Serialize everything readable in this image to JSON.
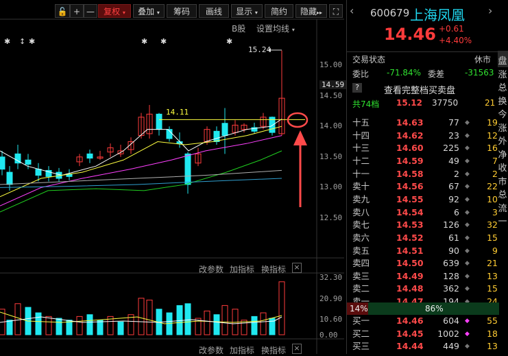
{
  "toolbar": {
    "lock": "🔓",
    "plus": "+",
    "minus": "—",
    "fuquan": "复权",
    "diejia": "叠加",
    "chouma": "筹码",
    "huaxian": "画线",
    "xianshi": "显示",
    "jianyue": "简约",
    "yincang": "隐藏",
    "expand": "⛶"
  },
  "chart": {
    "b_share": "B股",
    "settings": "设置均线",
    "high_label": "15.24",
    "ref_label": "14.11",
    "current_price_tag": "14.59",
    "price_ticks": [
      "15.00",
      "14.50",
      "14.00",
      "13.50",
      "13.00",
      "12.50"
    ],
    "vol_ticks": [
      "32.30",
      "20.90",
      "10.60",
      "0.00"
    ],
    "mid_controls": [
      "改参数",
      "加指标",
      "换指标"
    ],
    "bottom_controls": [
      "改参数",
      "加指标",
      "换指标"
    ],
    "close_x": "×"
  },
  "quote": {
    "code": "600679",
    "name": "上海凤凰",
    "price": "14.46",
    "change": "+0.61",
    "change_pct": "+4.40%",
    "trade_status_label": "交易状态",
    "trade_status": "休市",
    "tab": "盘",
    "weibi_label": "委比",
    "weibi": "-71.84%",
    "weicha_label": "委差",
    "weicha": "-31563",
    "help": "?",
    "full_book": "查看完整档买卖盘",
    "total_label": "共74档",
    "total_price": "15.12",
    "total_vol": "37750",
    "total_cnt": "21",
    "sells": [
      {
        "label": "十五",
        "price": "14.63",
        "vol": "77",
        "cnt": "19"
      },
      {
        "label": "十四",
        "price": "14.62",
        "vol": "23",
        "cnt": "12"
      },
      {
        "label": "十三",
        "price": "14.60",
        "vol": "225",
        "cnt": "16"
      },
      {
        "label": "十二",
        "price": "14.59",
        "vol": "49",
        "cnt": "7"
      },
      {
        "label": "十一",
        "price": "14.58",
        "vol": "2",
        "cnt": "2"
      },
      {
        "label": "卖十",
        "price": "14.56",
        "vol": "67",
        "cnt": "22"
      },
      {
        "label": "卖九",
        "price": "14.55",
        "vol": "92",
        "cnt": "10"
      },
      {
        "label": "卖八",
        "price": "14.54",
        "vol": "6",
        "cnt": "3"
      },
      {
        "label": "卖七",
        "price": "14.53",
        "vol": "126",
        "cnt": "32"
      },
      {
        "label": "卖六",
        "price": "14.52",
        "vol": "61",
        "cnt": "15"
      },
      {
        "label": "卖五",
        "price": "14.51",
        "vol": "90",
        "cnt": "9"
      },
      {
        "label": "卖四",
        "price": "14.50",
        "vol": "639",
        "cnt": "21"
      },
      {
        "label": "卖三",
        "price": "14.49",
        "vol": "128",
        "cnt": "13"
      },
      {
        "label": "卖二",
        "price": "14.48",
        "vol": "362",
        "cnt": "15"
      },
      {
        "label": "卖一",
        "price": "14.47",
        "vol": "194",
        "cnt": "24"
      }
    ],
    "ratio_left": "14%",
    "ratio_right": "86%",
    "buys": [
      {
        "label": "买一",
        "price": "14.46",
        "vol": "604",
        "cnt": "55",
        "dot": "#ff40ff"
      },
      {
        "label": "买二",
        "price": "14.45",
        "vol": "1002",
        "cnt": "18",
        "dot": "#ff40ff"
      },
      {
        "label": "买三",
        "price": "14.44",
        "vol": "449",
        "cnt": "13",
        "dot": "#777"
      }
    ],
    "side_chars": [
      "盘",
      "涨",
      "总",
      "换",
      "今",
      "涨",
      "外",
      "净",
      "收",
      "市",
      "总",
      "流",
      "一"
    ]
  },
  "colors": {
    "up": "#ff3b3b",
    "down": "#20e8f0",
    "ma5": "#ffffff",
    "ma10": "#ffff40",
    "ma20": "#ff40ff",
    "ma30": "#20d020",
    "ma60": "#b0b0b0"
  }
}
